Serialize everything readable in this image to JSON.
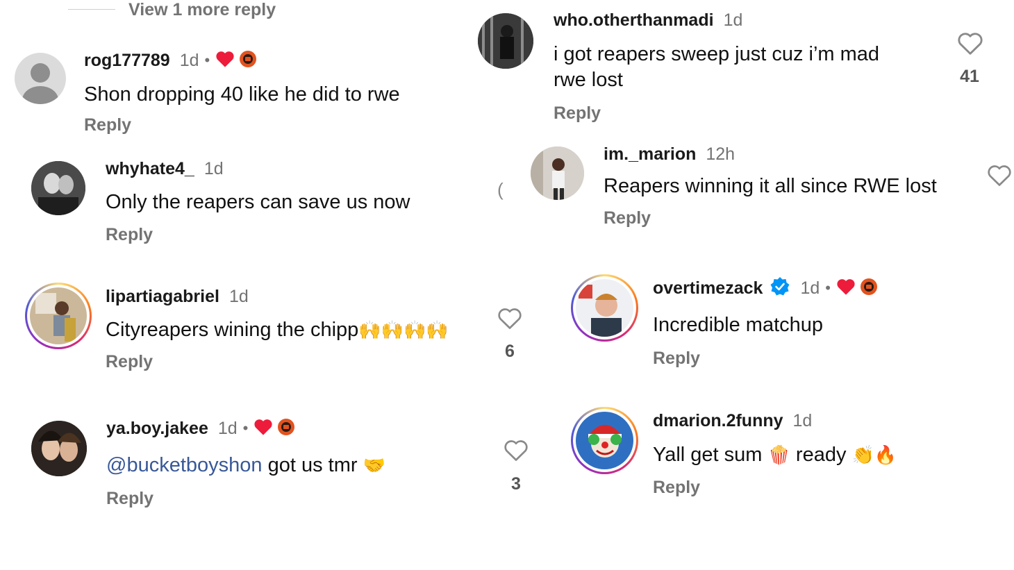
{
  "view_more": "View 1 more reply",
  "reply_label": "Reply",
  "comments": [
    {
      "user": "rog177789",
      "time": "1d",
      "text": "Shon dropping 40 like he did to rwe",
      "creator_liked": true
    },
    {
      "user": "whyhate4_",
      "time": "1d",
      "text": "Only the reapers can save us now"
    },
    {
      "user": "lipartiagabriel",
      "time": "1d",
      "text": "Cityreapers wining the chipp",
      "emoji": "🙌🙌🙌🙌",
      "likes": "6"
    },
    {
      "user": "ya.boy.jakee",
      "time": "1d",
      "mention": "@bucketboyshon",
      "text": " got us tmr ",
      "emoji": "🤝",
      "likes": "3",
      "creator_liked": true
    },
    {
      "user": "who.otherthanmadi",
      "time": "1d",
      "text_line1": "i got reapers sweep just cuz i’m mad",
      "text_line2": "rwe lost",
      "likes": "41"
    },
    {
      "user": "im._marion",
      "time": "12h",
      "text": "Reapers winning it all since RWE lost"
    },
    {
      "user": "overtimezack",
      "time": "1d",
      "text": "Incredible matchup",
      "verified": true,
      "creator_liked": true
    },
    {
      "user": "dmarion.2funny",
      "time": "1d",
      "text_a": "Yall get sum ",
      "emoji_a": "🍿",
      "text_b": " ready ",
      "emoji_b": "👏🔥"
    }
  ],
  "colors": {
    "heart_red": "#ed1c3b",
    "verified_blue": "#0095f6",
    "muted": "#737373"
  }
}
